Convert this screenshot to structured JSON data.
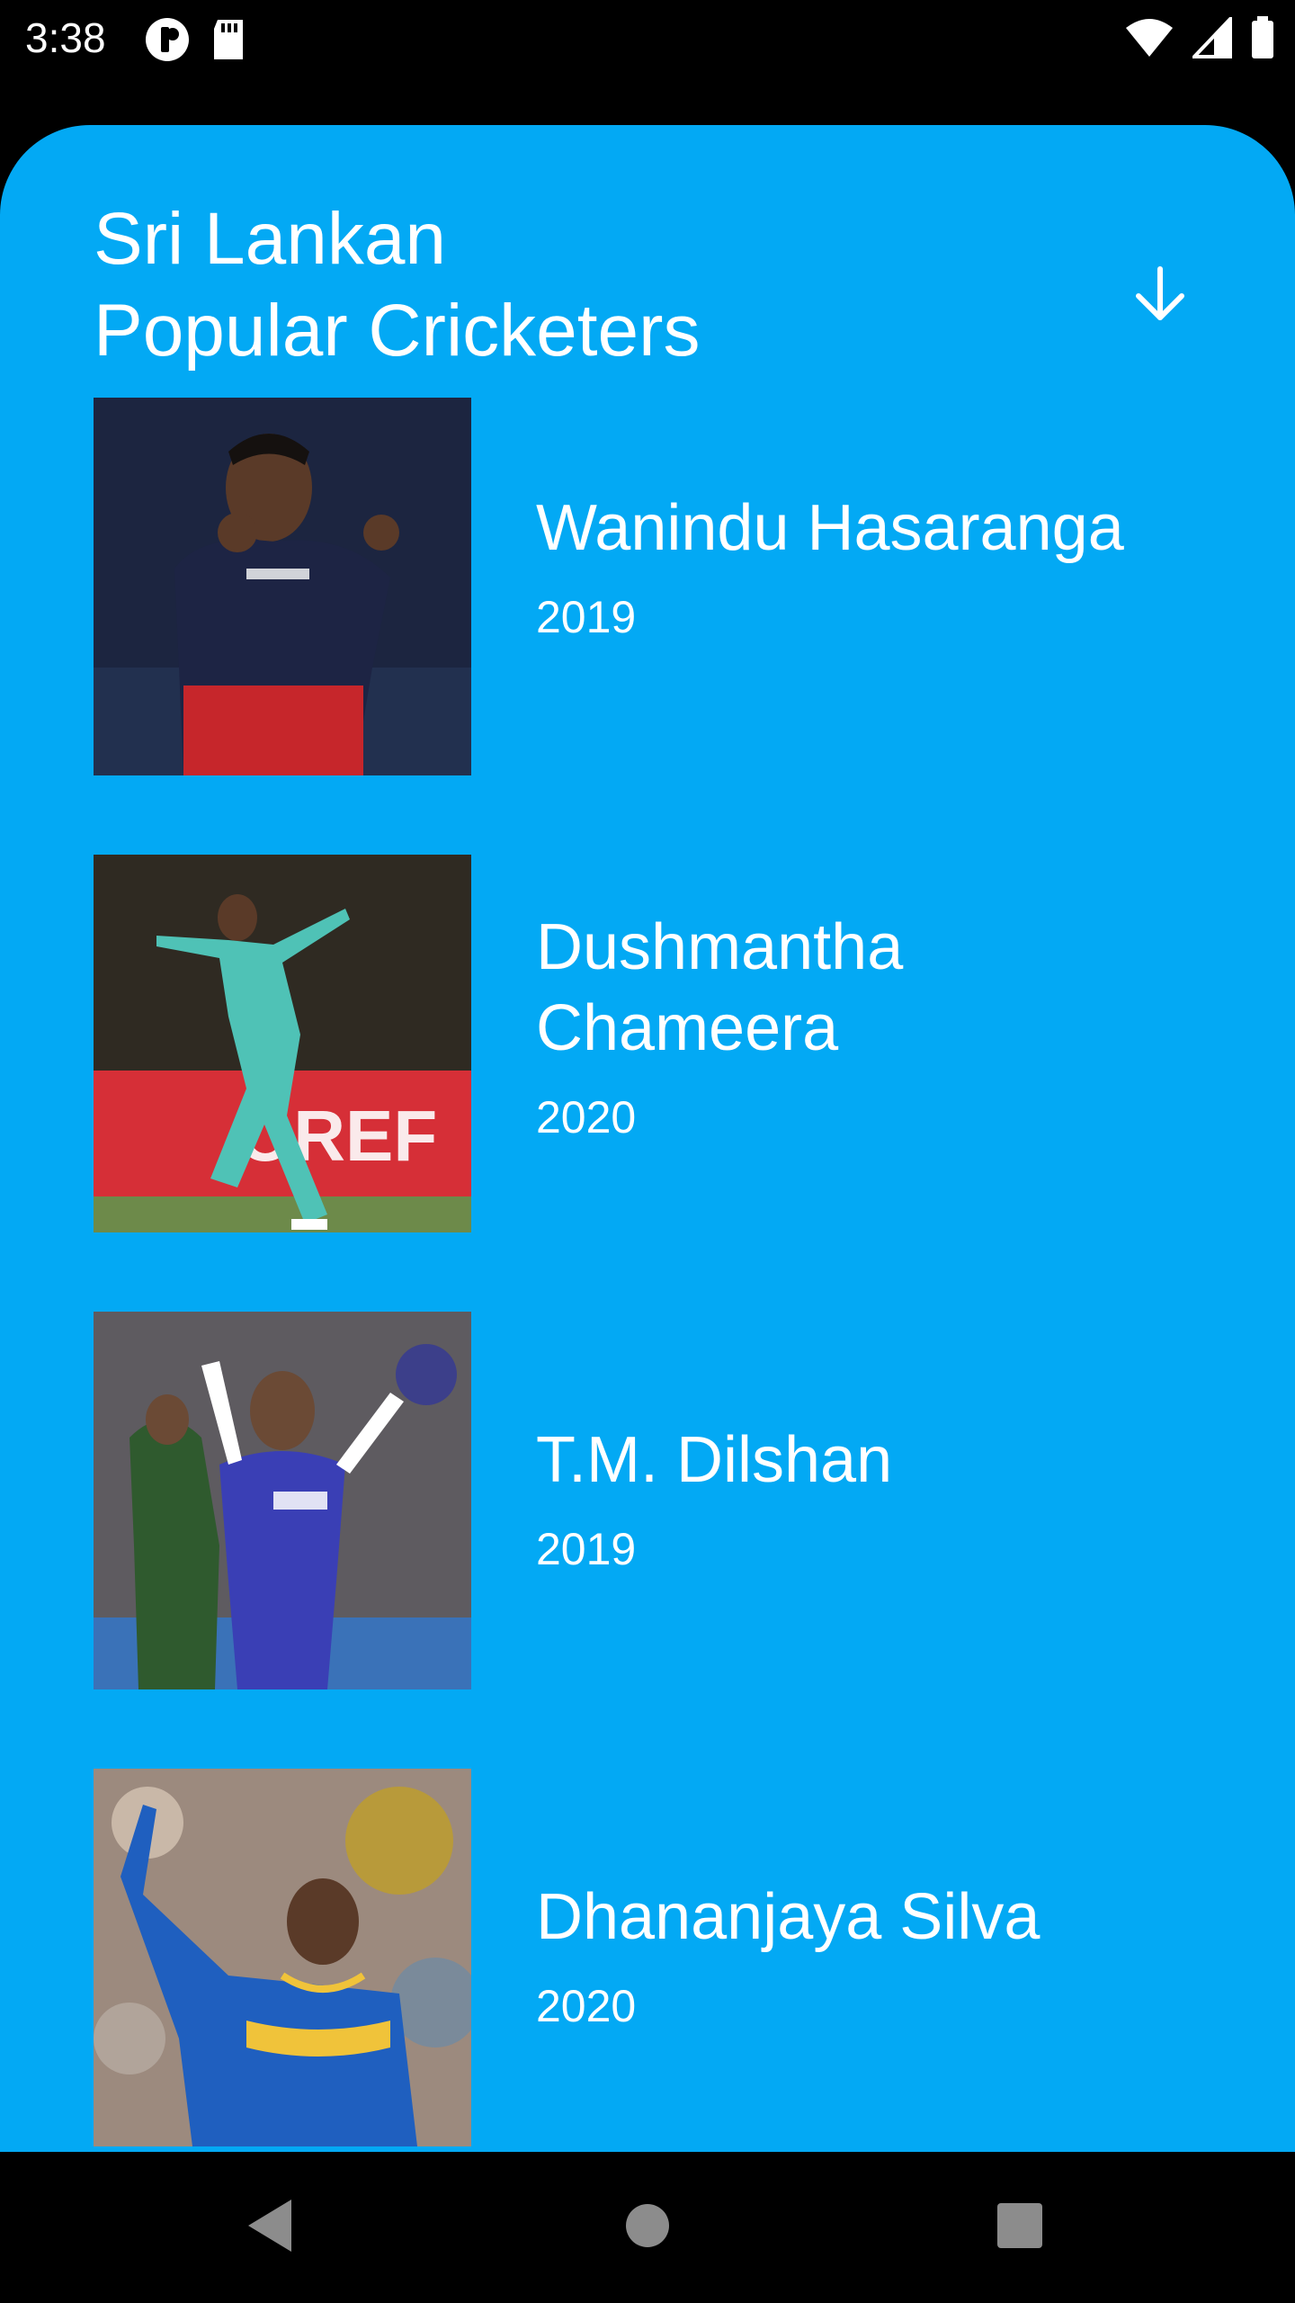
{
  "status_bar": {
    "time": "3:38",
    "left_icons": [
      "app-notification-icon",
      "sd-card-icon"
    ],
    "right_icons": [
      "wifi-icon",
      "cell-signal-icon",
      "battery-icon"
    ]
  },
  "header": {
    "title_line1": "Sri Lankan",
    "title_line2": "Popular Cricketers",
    "sort_icon": "arrow-down-icon"
  },
  "colors": {
    "sheet_background": "#03A9F4",
    "text": "#FFFFFF",
    "system_bars": "#000000"
  },
  "cricketers": [
    {
      "name": "Wanindu Hasaranga",
      "year": "2019"
    },
    {
      "name_line1": "Dushmantha",
      "name_line2": "Chameera",
      "year": "2020"
    },
    {
      "name": "T.M. Dilshan",
      "year": "2019"
    },
    {
      "name": "Dhananjaya Silva",
      "year": "2020"
    }
  ],
  "nav_bar": {
    "buttons": [
      "back-icon",
      "home-icon",
      "recents-icon"
    ]
  }
}
